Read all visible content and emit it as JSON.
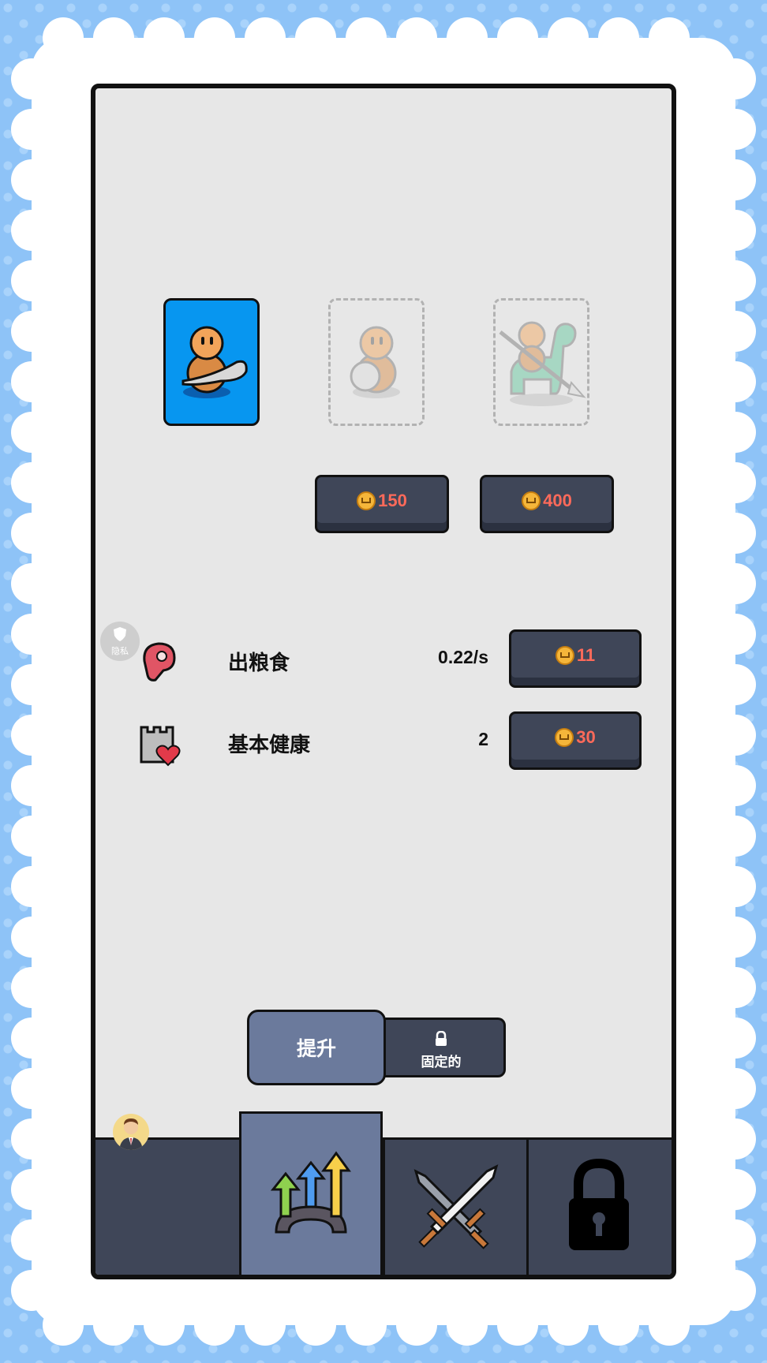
{
  "units": [
    {
      "name": "club-warrior",
      "state": "owned"
    },
    {
      "name": "shield-warrior",
      "state": "locked",
      "price": "150"
    },
    {
      "name": "dino-rider",
      "state": "locked",
      "price": "400"
    }
  ],
  "privacy_badge": "隐私",
  "stats": [
    {
      "label": "出粮食",
      "value": "0.22/s",
      "cost": "11",
      "icon": "meat-icon"
    },
    {
      "label": "基本健康",
      "value": "2",
      "cost": "30",
      "icon": "castle-heart-icon"
    }
  ],
  "subtabs": {
    "active_label": "提升",
    "locked_label": "固定的"
  },
  "nav": [
    {
      "icon": "upgrade-arrows-icon",
      "active": true
    },
    {
      "icon": "crossed-swords-icon",
      "active": false
    },
    {
      "icon": "padlock-icon",
      "active": false
    }
  ],
  "colors": {
    "card_blue": "#0796f0",
    "button_dark": "#3f4658",
    "active_tab": "#6b7a9c",
    "price_red": "#ff6a5a"
  }
}
